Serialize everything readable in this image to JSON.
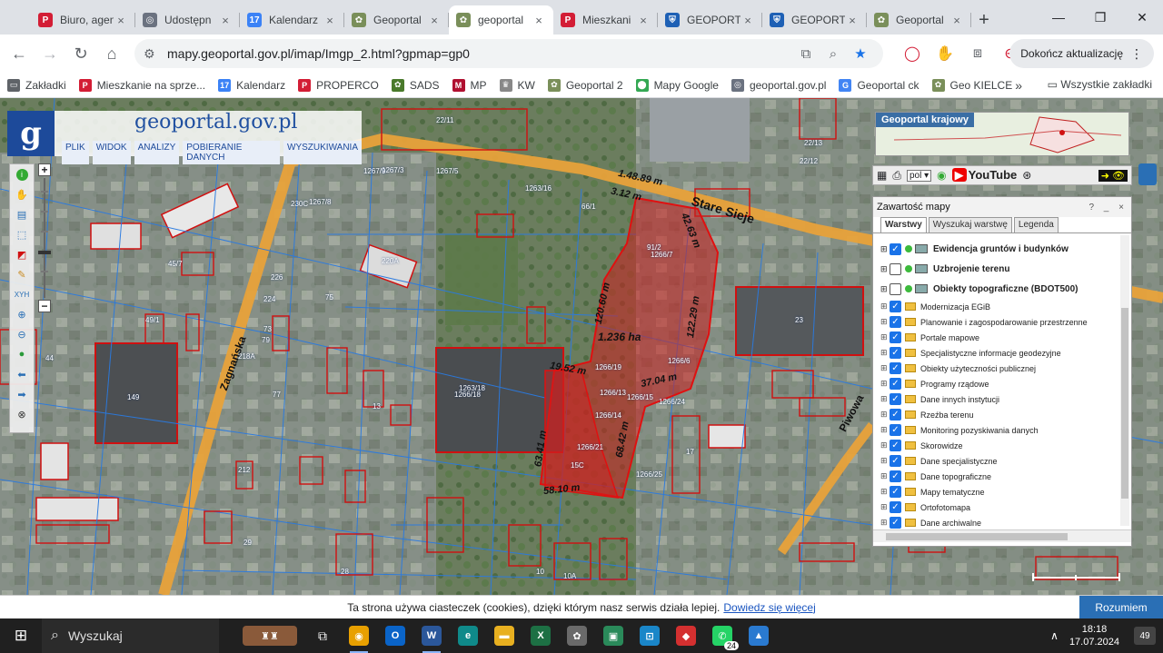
{
  "browser": {
    "tabs": [
      {
        "title": "Biuro, agen",
        "icon": "properco-p-icon",
        "color": "#d31d35",
        "glyph": "P"
      },
      {
        "title": "Udostępn",
        "icon": "globe-icon",
        "color": "#6b7280",
        "glyph": "◎"
      },
      {
        "title": "Kalendarz",
        "icon": "calendar-icon",
        "color": "#3b82f6",
        "glyph": "17"
      },
      {
        "title": "Geoportal",
        "icon": "geoportal-icon",
        "color": "#7a8f5a",
        "glyph": "✿"
      },
      {
        "title": "geoportal",
        "icon": "geoportal-icon",
        "color": "#7a8f5a",
        "glyph": "✿",
        "active": true
      },
      {
        "title": "Mieszkani",
        "icon": "properco-p-icon",
        "color": "#d31d35",
        "glyph": "P"
      },
      {
        "title": "GEOPORTA",
        "icon": "shield-icon",
        "color": "#1e60b5",
        "glyph": "⛨"
      },
      {
        "title": "GEOPORTA",
        "icon": "shield-icon",
        "color": "#1e60b5",
        "glyph": "⛨"
      },
      {
        "title": "Geoportal",
        "icon": "geoportal-icon",
        "color": "#7a8f5a",
        "glyph": "✿"
      }
    ],
    "new_tab": "+",
    "url": "mapy.geoportal.gov.pl/imap/Imgp_2.html?gpmap=gp0",
    "update_label": "Dokończ aktualizację",
    "bookmarks": [
      {
        "label": "Zakładki",
        "icon": "folder-icon",
        "color": "#5f6368",
        "glyph": "▭"
      },
      {
        "label": "Mieszkanie na sprze...",
        "icon": "properco-p-icon",
        "color": "#d31d35",
        "glyph": "P"
      },
      {
        "label": "Kalendarz",
        "icon": "calendar-icon",
        "color": "#3b82f6",
        "glyph": "17"
      },
      {
        "label": "PROPERCO",
        "icon": "properco-p-icon",
        "color": "#d31d35",
        "glyph": "P"
      },
      {
        "label": "SADS",
        "icon": "sads-icon",
        "color": "#4a7a2c",
        "glyph": "✿"
      },
      {
        "label": "MP",
        "icon": "mp-icon",
        "color": "#b01030",
        "glyph": "M"
      },
      {
        "label": "KW",
        "icon": "eagle-icon",
        "color": "#888888",
        "glyph": "♛"
      },
      {
        "label": "Geoportal 2",
        "icon": "geoportal-icon",
        "color": "#7a8f5a",
        "glyph": "✿"
      },
      {
        "label": "Mapy Google",
        "icon": "map-pin-icon",
        "color": "#34a853",
        "glyph": "⬤"
      },
      {
        "label": "geoportal.gov.pl",
        "icon": "globe-icon",
        "color": "#6b7280",
        "glyph": "◎"
      },
      {
        "label": "Geoportal ck",
        "icon": "google-g-icon",
        "color": "#4285f4",
        "glyph": "G"
      },
      {
        "label": "Geo KIELCE",
        "icon": "geoportal-icon",
        "color": "#7a8f5a",
        "glyph": "✿"
      }
    ],
    "bookmarks_more": "»",
    "all_bookmarks": "Wszystkie zakładki"
  },
  "geoportal": {
    "site_title": "geoportal.gov.pl",
    "menu": [
      "PLIK",
      "WIDOK",
      "ANALIZY",
      "POBIERANIE DANYCH",
      "WYSZUKIWANIA"
    ],
    "minimap_label": "Geoportal krajowy",
    "lang": "pol",
    "youtube": "YouTube",
    "panel": {
      "title": "Zawartość mapy",
      "header_controls": "? _ ×",
      "tabs": [
        "Warstwy",
        "Wyszukaj warstwę",
        "Legenda"
      ],
      "layers": [
        {
          "label": "Ewidencja gruntów i budynków",
          "checked": true,
          "big": true
        },
        {
          "label": "Uzbrojenie terenu",
          "checked": false,
          "big": true
        },
        {
          "label": "Obiekty topograficzne (BDOT500)",
          "checked": false,
          "big": true
        },
        {
          "label": "Modernizacja EGiB",
          "checked": true
        },
        {
          "label": "Planowanie i zagospodarowanie przestrzenne",
          "checked": true
        },
        {
          "label": "Portale mapowe",
          "checked": true
        },
        {
          "label": "Specjalistyczne informacje geodezyjne",
          "checked": true
        },
        {
          "label": "Obiekty użyteczności publicznej",
          "checked": true
        },
        {
          "label": "Programy rządowe",
          "checked": true
        },
        {
          "label": "Dane innych instytucji",
          "checked": true
        },
        {
          "label": "Rzeźba terenu",
          "checked": true
        },
        {
          "label": "Monitoring pozyskiwania danych",
          "checked": true
        },
        {
          "label": "Skorowidze",
          "checked": true
        },
        {
          "label": "Dane specjalistyczne",
          "checked": true
        },
        {
          "label": "Dane topograficzne",
          "checked": true
        },
        {
          "label": "Mapy tematyczne",
          "checked": true
        },
        {
          "label": "Ortofotomapa",
          "checked": true
        },
        {
          "label": "Dane archiwalne",
          "checked": true
        }
      ]
    },
    "map_labels": {
      "street_1": "Stare Sieje",
      "street_2": "Zagnańska",
      "street_3": "Piwowa",
      "area": "1.236 ha",
      "m1": "1.48.89 m",
      "m2": "3.12 m",
      "m3": "42.63 m",
      "m4": "120.60 m",
      "m5": "122.29 m",
      "m6": "19.52 m",
      "m7": "37.04 m",
      "m8": "58.10 m",
      "m9": "68.42 m",
      "m10": "63.41 m",
      "plots": [
        "1263/18",
        "1266/18",
        "1266/19",
        "1266/13",
        "1266/14",
        "1266/15",
        "1266/25",
        "1266/21",
        "1266/24",
        "1266/6",
        "220A",
        "218A",
        "224",
        "226",
        "230C",
        "75",
        "77",
        "79",
        "73",
        "149",
        "28",
        "29",
        "17",
        "15C",
        "13",
        "212",
        "10",
        "10A",
        "1266/7",
        "1263/16",
        "66/1",
        "45/7",
        "44",
        "49/1",
        "1267/3",
        "1267/5",
        "1267/8",
        "1267/9",
        "22/11",
        "22/12",
        "22/13",
        "91/2",
        "23"
      ]
    },
    "scale": "50 m"
  },
  "cookie": {
    "text": "Ta strona używa ciasteczek (cookies), dzięki którym nasz serwis działa lepiej.",
    "link": "Dowiedz się więcej",
    "button": "Rozumiem"
  },
  "taskbar": {
    "search_placeholder": "Wyszukaj",
    "apps": [
      {
        "name": "chrome-icon",
        "color": "#e8a000",
        "glyph": "◉",
        "active": true
      },
      {
        "name": "outlook-icon",
        "color": "#0a64c8",
        "glyph": "O"
      },
      {
        "name": "word-icon",
        "color": "#2b579a",
        "glyph": "W",
        "active": true
      },
      {
        "name": "edge-icon",
        "color": "#0f8a8a",
        "glyph": "e"
      },
      {
        "name": "explorer-icon",
        "color": "#e8b020",
        "glyph": "▬"
      },
      {
        "name": "excel-icon",
        "color": "#1d7044",
        "glyph": "X"
      },
      {
        "name": "app-icon",
        "color": "#6a6a6a",
        "glyph": "✿"
      },
      {
        "name": "monitor-icon",
        "color": "#2a8a5a",
        "glyph": "▣"
      },
      {
        "name": "teams-icon",
        "color": "#1a86c8",
        "glyph": "⊡"
      },
      {
        "name": "anydesk-icon",
        "color": "#d43030",
        "glyph": "◆"
      },
      {
        "name": "whatsapp-icon",
        "color": "#25d366",
        "glyph": "✆",
        "badge": "24"
      },
      {
        "name": "photos-icon",
        "color": "#2a7ad0",
        "glyph": "▲"
      }
    ],
    "time": "18:18",
    "date": "17.07.2024",
    "notifications": "49"
  }
}
